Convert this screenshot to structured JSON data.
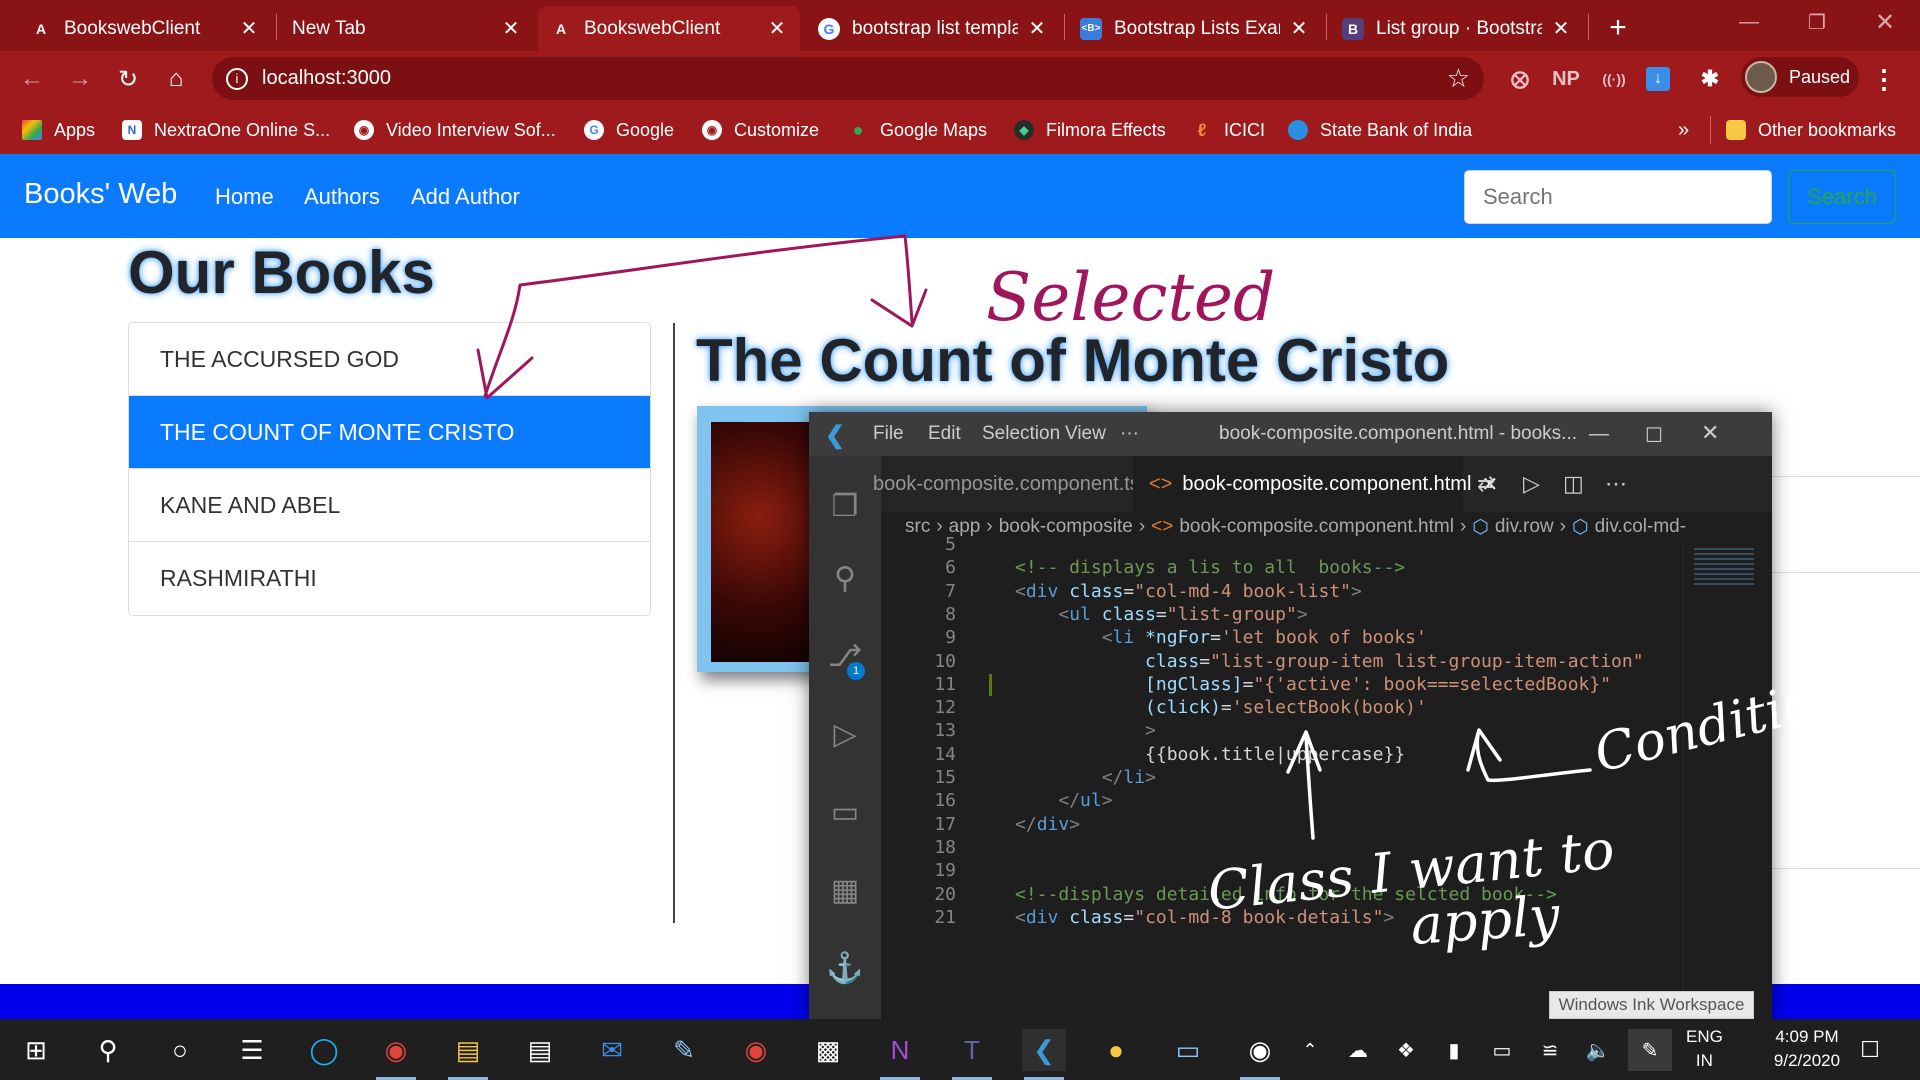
{
  "browser": {
    "tabs": [
      {
        "title": "BookswebClient",
        "icon": "A",
        "active": false
      },
      {
        "title": "New Tab",
        "icon": "",
        "active": false
      },
      {
        "title": "BookswebClient",
        "icon": "A",
        "active": true
      },
      {
        "title": "bootstrap list templa",
        "icon": "G",
        "active": false
      },
      {
        "title": "Bootstrap Lists Exam",
        "icon": "<B>",
        "active": false
      },
      {
        "title": "List group · Bootstrap",
        "icon": "B",
        "active": false
      }
    ],
    "new_tab_symbol": "+",
    "close_symbol": "✕",
    "url": "localhost:3000",
    "profile_label": "Paused",
    "extensions": [
      "NP"
    ],
    "bookmarks": [
      {
        "label": "Apps"
      },
      {
        "label": "NextraOne Online S..."
      },
      {
        "label": "Video Interview Sof..."
      },
      {
        "label": "Google"
      },
      {
        "label": "Customize"
      },
      {
        "label": "Google Maps"
      },
      {
        "label": "Filmora Effects"
      },
      {
        "label": "ICICI"
      },
      {
        "label": "State Bank of India"
      }
    ],
    "bookmarks_overflow": "»",
    "other_bookmarks": "Other bookmarks",
    "accent_color": "#9f1a1d"
  },
  "app": {
    "brand": "Books' Web",
    "nav": [
      "Home",
      "Authors",
      "Add Author"
    ],
    "search_placeholder": "Search",
    "search_button": "Search",
    "heading": "Our Books",
    "books": [
      {
        "title": "THE ACCURSED GOD",
        "active": false
      },
      {
        "title": "THE COUNT OF MONTE CRISTO",
        "active": true
      },
      {
        "title": "KANE AND ABEL",
        "active": false
      },
      {
        "title": "RASHMIRATHI",
        "active": false
      }
    ],
    "selected_title": "The Count of Monte Cristo",
    "primary_color": "#0a7bfe"
  },
  "vscode": {
    "menus": [
      "File",
      "Edit",
      "Selection",
      "View",
      "···"
    ],
    "window_title": "book-composite.component.html - books...",
    "tabs": [
      {
        "label": "book-composite.component.ts",
        "active": false
      },
      {
        "label": "book-composite.component.html",
        "active": true
      }
    ],
    "breadcrumb": [
      "src",
      "app",
      "book-composite",
      "book-composite.component.html",
      "div.row",
      "div.col-md-"
    ],
    "scm_badge": "1",
    "lines": [
      {
        "n": "5",
        "tokens": []
      },
      {
        "n": "6",
        "tokens": [
          [
            "com",
            "<!-- displays a lis to all  books-->"
          ]
        ]
      },
      {
        "n": "7",
        "tokens": [
          [
            "gry",
            "<"
          ],
          [
            "tag",
            "div"
          ],
          [
            "attr",
            " class"
          ],
          [
            "txt",
            "="
          ],
          [
            "str",
            "\"col-md-4 book-list\""
          ],
          [
            "gry",
            ">"
          ]
        ]
      },
      {
        "n": "8",
        "tokens": [
          [
            "txt",
            "    "
          ],
          [
            "gry",
            "<"
          ],
          [
            "tag",
            "ul"
          ],
          [
            "attr",
            " class"
          ],
          [
            "txt",
            "="
          ],
          [
            "str",
            "\"list-group\""
          ],
          [
            "gry",
            ">"
          ]
        ]
      },
      {
        "n": "9",
        "tokens": [
          [
            "txt",
            "        "
          ],
          [
            "gry",
            "<"
          ],
          [
            "tag",
            "li"
          ],
          [
            "attr",
            " *ngFor"
          ],
          [
            "txt",
            "="
          ],
          [
            "str",
            "'let book of books'"
          ]
        ]
      },
      {
        "n": "10",
        "tokens": [
          [
            "txt",
            "            "
          ],
          [
            "attr",
            "class"
          ],
          [
            "txt",
            "="
          ],
          [
            "str",
            "\"list-group-item list-group-item-action\""
          ]
        ]
      },
      {
        "n": "11",
        "tokens": [
          [
            "txt",
            "            "
          ],
          [
            "attr",
            "[ngClass]"
          ],
          [
            "txt",
            "="
          ],
          [
            "str",
            "\"{'active': book===selectedBook}\""
          ]
        ]
      },
      {
        "n": "12",
        "tokens": [
          [
            "txt",
            "            "
          ],
          [
            "attr",
            "(click)"
          ],
          [
            "txt",
            "="
          ],
          [
            "str",
            "'selectBook(book)'"
          ]
        ]
      },
      {
        "n": "13",
        "tokens": [
          [
            "txt",
            "            "
          ],
          [
            "gry",
            ">"
          ]
        ]
      },
      {
        "n": "14",
        "tokens": [
          [
            "txt",
            "            {{book.title|uppercase}}"
          ]
        ]
      },
      {
        "n": "15",
        "tokens": [
          [
            "txt",
            "        "
          ],
          [
            "gry",
            "</"
          ],
          [
            "tag",
            "li"
          ],
          [
            "gry",
            ">"
          ]
        ]
      },
      {
        "n": "16",
        "tokens": [
          [
            "txt",
            "    "
          ],
          [
            "gry",
            "</"
          ],
          [
            "tag",
            "ul"
          ],
          [
            "gry",
            ">"
          ]
        ]
      },
      {
        "n": "17",
        "tokens": [
          [
            "gry",
            "</"
          ],
          [
            "tag",
            "div"
          ],
          [
            "gry",
            ">"
          ]
        ]
      },
      {
        "n": "18",
        "tokens": []
      },
      {
        "n": "19",
        "tokens": []
      },
      {
        "n": "20",
        "tokens": [
          [
            "com",
            "<!--displays detailed info for the selcted book-->"
          ]
        ]
      },
      {
        "n": "21",
        "tokens": [
          [
            "gry",
            "<"
          ],
          [
            "tag",
            "div"
          ],
          [
            "attr",
            " class"
          ],
          [
            "txt",
            "="
          ],
          [
            "str",
            "\"col-md-8 book-details\""
          ],
          [
            "gry",
            ">"
          ]
        ]
      }
    ]
  },
  "ink": {
    "selected": "Selected",
    "condition": "Condition",
    "class_note_1": "Class I want to",
    "class_note_2": "apply",
    "ink_color": "#a0165c"
  },
  "ink_workspace_label": "Windows Ink Workspace",
  "taskbar": {
    "lang_1": "ENG",
    "lang_2": "IN",
    "time": "4:09 PM",
    "date": "9/2/2020"
  }
}
